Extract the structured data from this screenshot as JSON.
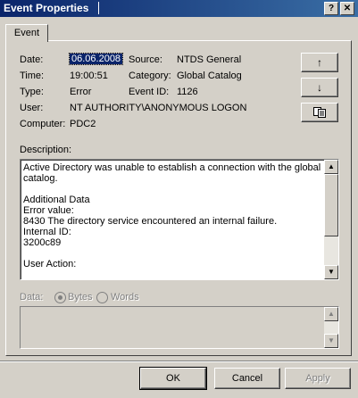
{
  "window": {
    "title": "Event Properties",
    "help_label": "?",
    "close_label": "✕"
  },
  "tabs": [
    {
      "label": "Event"
    }
  ],
  "fields": {
    "date_label": "Date:",
    "date_value": "06.06.2008",
    "time_label": "Time:",
    "time_value": "19:00:51",
    "type_label": "Type:",
    "type_value": "Error",
    "user_label": "User:",
    "user_value": "NT AUTHORITY\\ANONYMOUS LOGON",
    "computer_label": "Computer:",
    "computer_value": "PDC2",
    "source_label": "Source:",
    "source_value": "NTDS General",
    "category_label": "Category:",
    "category_value": "Global Catalog",
    "eventid_label": "Event ID:",
    "eventid_value": "1126"
  },
  "nav_buttons": {
    "up": "↑",
    "down": "↓",
    "copy_icon": "copy-icon"
  },
  "description": {
    "label": "Description:",
    "text": "Active Directory was unable to establish a connection with the global catalog.\n\nAdditional Data\nError value:\n8430 The directory service encountered an internal failure.\nInternal ID:\n3200c89\n\nUser Action:"
  },
  "data_section": {
    "label": "Data:",
    "bytes_label": "Bytes",
    "words_label": "Words",
    "selected": "Bytes"
  },
  "buttons": {
    "ok": "OK",
    "cancel": "Cancel",
    "apply": "Apply"
  }
}
